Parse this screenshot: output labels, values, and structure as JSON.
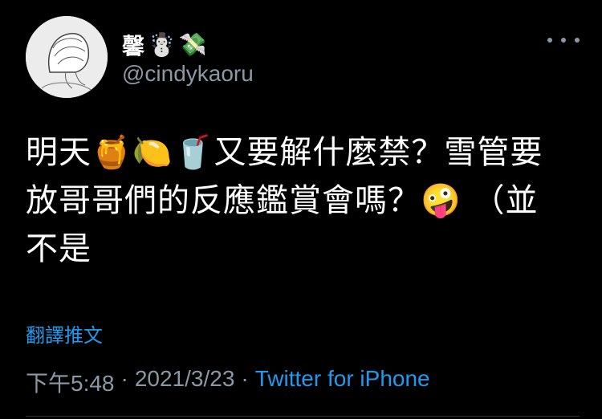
{
  "profile": {
    "display_name": "馨",
    "name_emojis": [
      "☃️",
      "💸"
    ],
    "handle": "@cindykaoru"
  },
  "icons": {
    "avatar": "avatar-sketch",
    "more": "more-options-icon"
  },
  "tweet": {
    "line1": "明天🍯🍋🥤又要解什麼禁？雪管要",
    "line2": "放哥哥們的反應鑑賞會嗎？🤪 （並",
    "line3": "不是"
  },
  "translate_label": "翻譯推文",
  "meta": {
    "time": "下午5:48",
    "sep1": "·",
    "date": "2021/3/23",
    "sep2": "·",
    "source": "Twitter for iPhone"
  },
  "colors": {
    "background": "#000000",
    "link": "#1d9bf0",
    "muted": "#8b98a5"
  }
}
